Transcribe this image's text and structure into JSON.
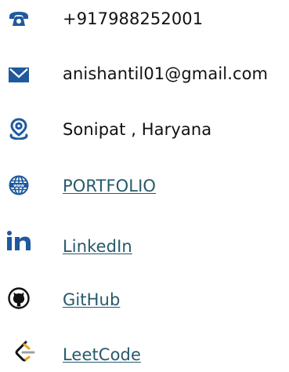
{
  "contacts": {
    "phone": {
      "text": "+917988252001",
      "icon": "phone-icon"
    },
    "email": {
      "text": "anishantil01@gmail.com",
      "icon": "mail-icon"
    },
    "location": {
      "text": "Sonipat , Haryana",
      "icon": "location-pin-icon"
    },
    "portfolio": {
      "text": "PORTFOLIO",
      "icon": "globe-icon"
    },
    "linkedin": {
      "text": "LinkedIn",
      "icon": "linkedin-icon"
    },
    "github": {
      "text": "GitHub",
      "icon": "github-icon"
    },
    "leetcode": {
      "text": "LeetCode",
      "icon": "leetcode-icon"
    }
  },
  "colors": {
    "icon_blue": "#1e5a9d",
    "link_teal": "#27596b",
    "text": "#111111",
    "background": "#ffffff"
  }
}
